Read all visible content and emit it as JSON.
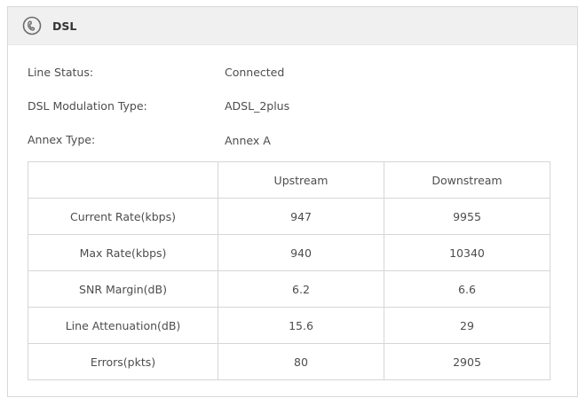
{
  "panel": {
    "title": "DSL",
    "icon": "dsl-phone-icon"
  },
  "info": [
    {
      "label": "Line Status:",
      "value": "Connected"
    },
    {
      "label": "DSL Modulation Type:",
      "value": "ADSL_2plus"
    },
    {
      "label": "Annex Type:",
      "value": "Annex A"
    }
  ],
  "table": {
    "headers": [
      "",
      "Upstream",
      "Downstream"
    ],
    "rows": [
      {
        "label": "Current Rate(kbps)",
        "upstream": "947",
        "downstream": "9955"
      },
      {
        "label": "Max Rate(kbps)",
        "upstream": "940",
        "downstream": "10340"
      },
      {
        "label": "SNR Margin(dB)",
        "upstream": "6.2",
        "downstream": "6.6"
      },
      {
        "label": "Line Attenuation(dB)",
        "upstream": "15.6",
        "downstream": "29"
      },
      {
        "label": "Errors(pkts)",
        "upstream": "80",
        "downstream": "2905"
      }
    ]
  }
}
